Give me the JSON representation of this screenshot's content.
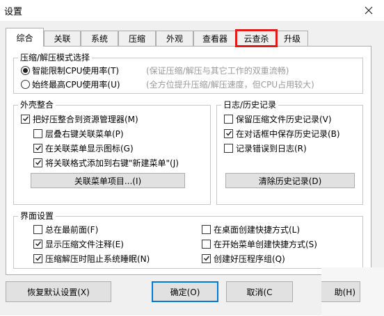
{
  "window": {
    "title": "设置"
  },
  "tabs": [
    {
      "label": "综合",
      "active": true
    },
    {
      "label": "关联"
    },
    {
      "label": "系统"
    },
    {
      "label": "压缩"
    },
    {
      "label": "外观"
    },
    {
      "label": "查看器"
    },
    {
      "label": "云查杀",
      "highlighted": true
    },
    {
      "label": "升级"
    }
  ],
  "compression_mode": {
    "title": "压缩/解压模式选择",
    "options": [
      {
        "label": "智能限制CPU使用率(T)",
        "hint": "(保证压缩/解压与其它工作的双重流畅)",
        "selected": true
      },
      {
        "label": "始终最高CPU使用率(U)",
        "hint": "(全方位提升压缩/解压速度，但CPU占用较大)",
        "selected": false
      }
    ]
  },
  "shell": {
    "title": "外壳整合",
    "options": [
      {
        "label": "把好压整合到资源管理器(M)",
        "checked": true
      },
      {
        "label": "层叠右键关联菜单(P)",
        "checked": false
      },
      {
        "label": "在关联菜单显示图标(G)",
        "checked": true
      },
      {
        "label": "将关联格式添加到右键\"新建菜单\"(J)",
        "checked": true
      }
    ],
    "button": "关联菜单项目...(I)"
  },
  "history": {
    "title": "日志/历史记录",
    "options": [
      {
        "label": "保留压缩文件历史记录(V)",
        "checked": false
      },
      {
        "label": "在对话框中保存历史记录(B)",
        "checked": true
      },
      {
        "label": "记录错误到日志(R)",
        "checked": false
      }
    ],
    "button": "清除历史记录(D)"
  },
  "interface": {
    "title": "界面设置",
    "left": [
      {
        "label": "总在最前面(F)",
        "checked": false
      },
      {
        "label": "显示压缩文件注释(E)",
        "checked": true
      },
      {
        "label": "压缩解压时阻止系统睡眠(N)",
        "checked": true
      }
    ],
    "right": [
      {
        "label": "在桌面创建快捷方式(L)",
        "checked": false
      },
      {
        "label": "在开始菜单创建快捷方式(S)",
        "checked": false
      },
      {
        "label": "创建好压程序组(Q)",
        "checked": true
      }
    ]
  },
  "footer": {
    "restore": "恢复默认设置(X)",
    "ok": "确定(O)",
    "cancel": "取消(C",
    "help": "助(H)"
  }
}
